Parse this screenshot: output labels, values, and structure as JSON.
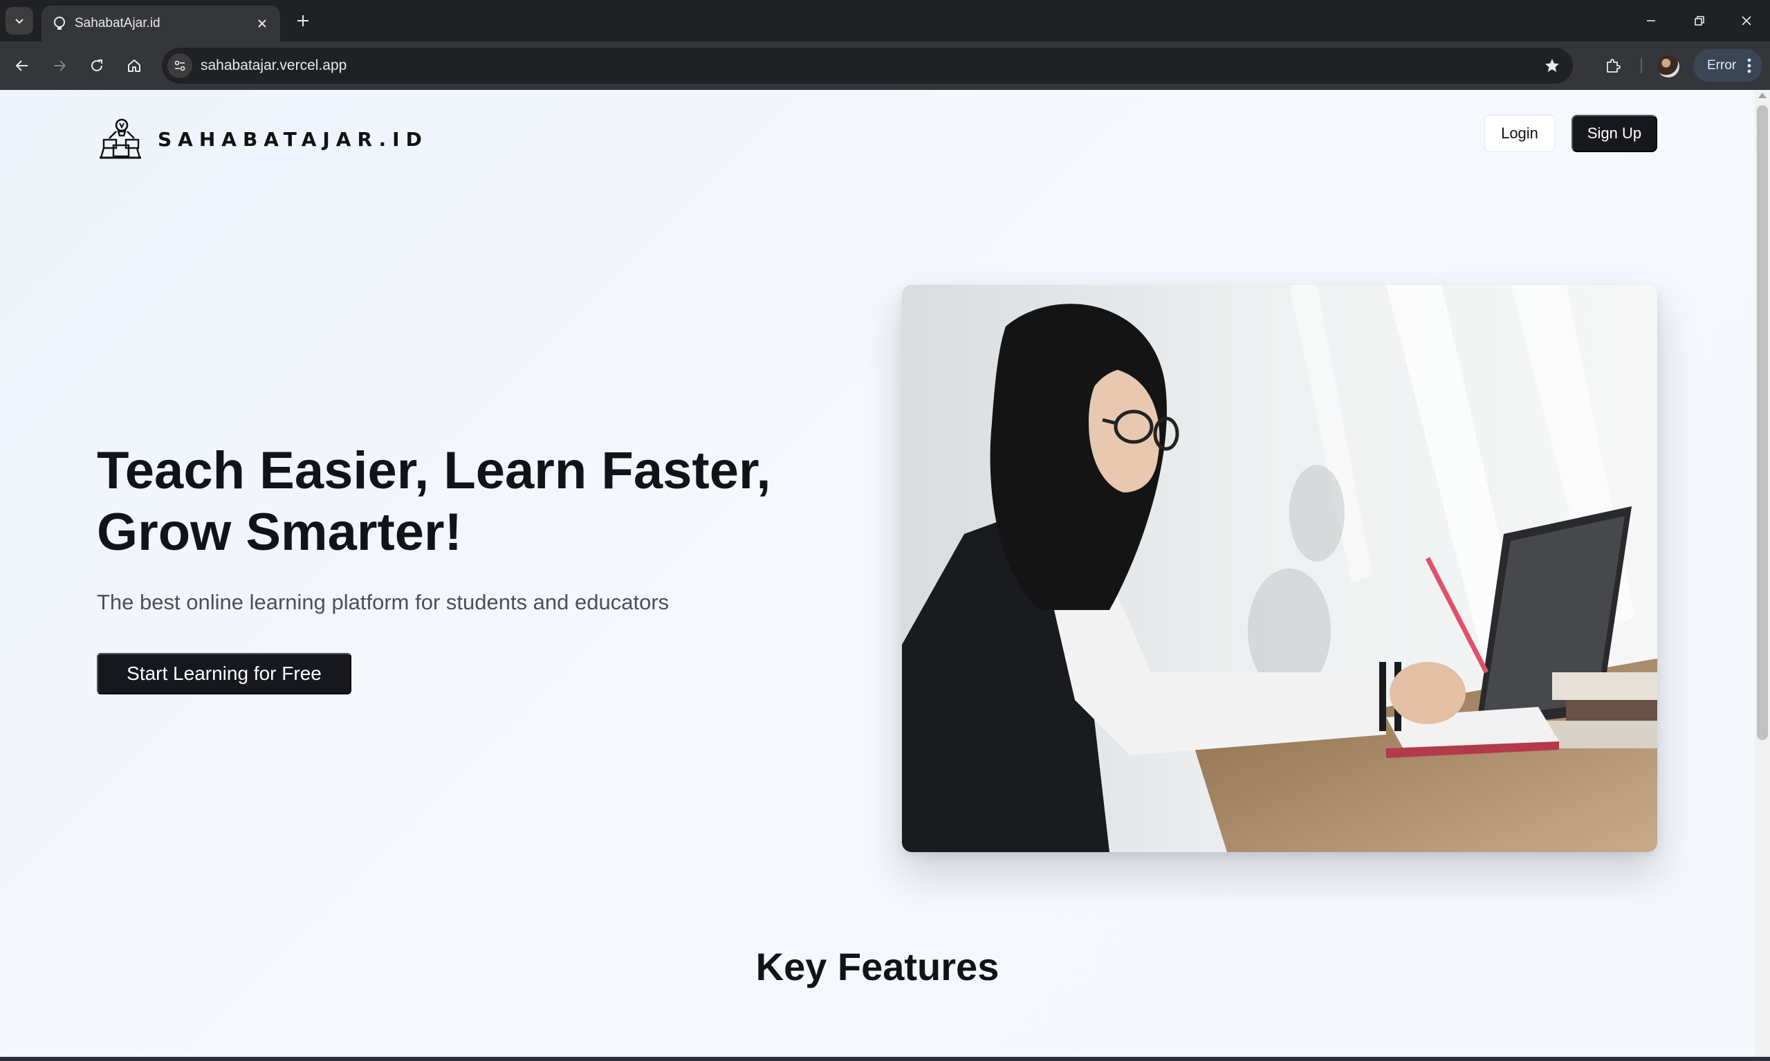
{
  "browser": {
    "tab_title": "SahabatAjar.id",
    "url": "sahabatajar.vercel.app",
    "profile_status": "Error"
  },
  "header": {
    "brand": "SAHABATAJAR.ID",
    "login_label": "Login",
    "signup_label": "Sign Up"
  },
  "hero": {
    "title": "Teach Easier, Learn Faster, Grow Smarter!",
    "subtitle": "The best online learning platform for students and educators",
    "cta_label": "Start Learning for Free",
    "image_icon": "student-studying-photo"
  },
  "features": {
    "section_title": "Key Features"
  },
  "colors": {
    "primary_button": "#16181d",
    "page_background": "#f3f6fc",
    "text_dark": "#111318",
    "text_muted": "#4b5058"
  }
}
